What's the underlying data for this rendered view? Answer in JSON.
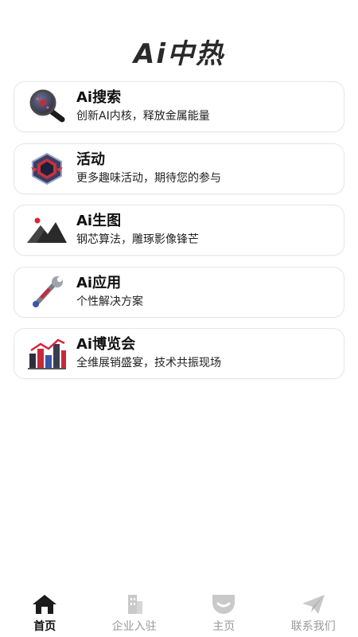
{
  "header": {
    "title": "Ai中热"
  },
  "menu": [
    {
      "title": "Ai搜索",
      "desc": "创新AI内核，释放金属能量",
      "icon": "magnifier-icon"
    },
    {
      "title": "活动",
      "desc": "更多趣味活动，期待您的参与",
      "icon": "activity-badge-icon"
    },
    {
      "title": "Ai生图",
      "desc": "钢芯算法，雕琢影像锋芒",
      "icon": "mountain-image-icon"
    },
    {
      "title": "Ai应用",
      "desc": "个性解决方案",
      "icon": "wrench-icon"
    },
    {
      "title": "Ai博览会",
      "desc": "全维展销盛宴，技术共振现场",
      "icon": "bar-chart-icon"
    }
  ],
  "tabbar": {
    "active_index": 0,
    "items": [
      {
        "label": "首页",
        "icon": "home-icon"
      },
      {
        "label": "企业入驻",
        "icon": "building-icon"
      },
      {
        "label": "主页",
        "icon": "profile-home-icon"
      },
      {
        "label": "联系我们",
        "icon": "paper-plane-icon"
      }
    ]
  }
}
